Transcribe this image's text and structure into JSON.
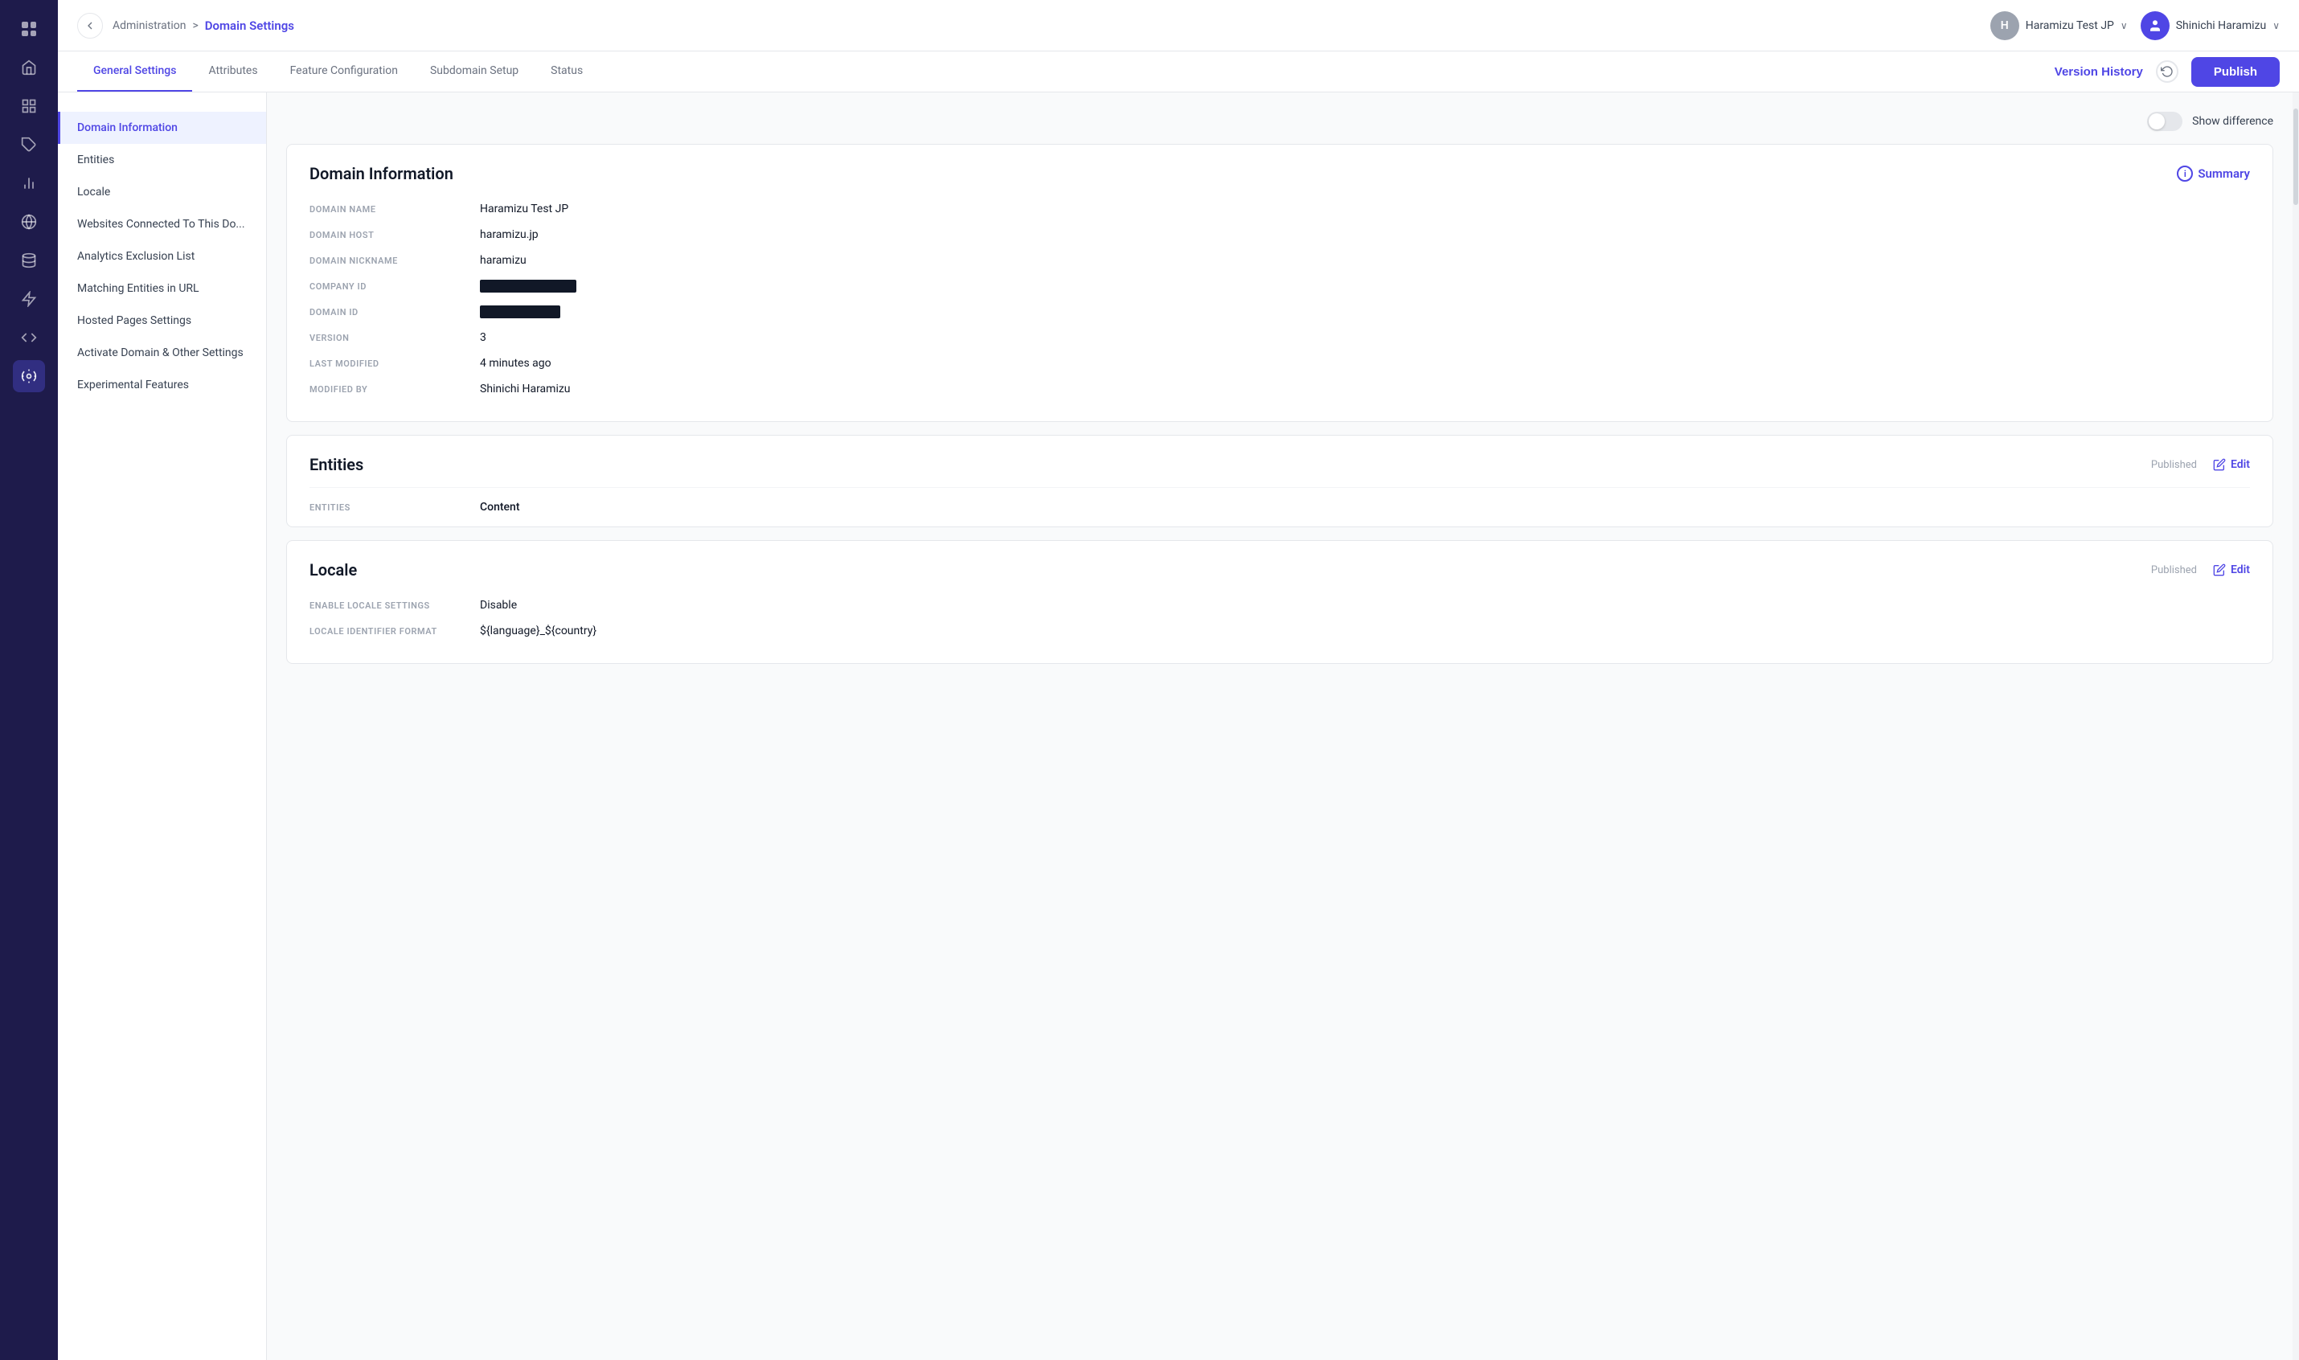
{
  "app": {
    "title": "Domain Settings"
  },
  "header": {
    "back_label": "←",
    "breadcrumb_admin": "Administration",
    "breadcrumb_sep": ">",
    "breadcrumb_current": "Domain Settings",
    "org_initial": "H",
    "org_name": "Haramizu Test JP",
    "chevron": "∨",
    "user_icon": "👤",
    "user_name": "Shinichi Haramizu"
  },
  "tabs": {
    "items": [
      {
        "label": "General Settings",
        "active": true
      },
      {
        "label": "Attributes",
        "active": false
      },
      {
        "label": "Feature Configuration",
        "active": false
      },
      {
        "label": "Subdomain Setup",
        "active": false
      },
      {
        "label": "Status",
        "active": false
      }
    ],
    "version_history": "Version History",
    "publish": "Publish"
  },
  "left_nav": {
    "items": [
      {
        "label": "Domain Information",
        "active": true
      },
      {
        "label": "Entities",
        "active": false
      },
      {
        "label": "Locale",
        "active": false
      },
      {
        "label": "Websites Connected To This Do...",
        "active": false
      },
      {
        "label": "Analytics Exclusion List",
        "active": false
      },
      {
        "label": "Matching Entities in URL",
        "active": false
      },
      {
        "label": "Hosted Pages Settings",
        "active": false
      },
      {
        "label": "Activate Domain & Other Settings",
        "active": false
      },
      {
        "label": "Experimental Features",
        "active": false
      }
    ]
  },
  "show_difference": {
    "label": "Show difference"
  },
  "domain_information": {
    "title": "Domain Information",
    "summary_label": "Summary",
    "fields": [
      {
        "label": "DOMAIN NAME",
        "value": "Haramizu Test JP",
        "redacted": false
      },
      {
        "label": "DOMAIN HOST",
        "value": "haramizu.jp",
        "redacted": false
      },
      {
        "label": "DOMAIN NICKNAME",
        "value": "haramizu",
        "redacted": false
      },
      {
        "label": "COMPANY ID",
        "value": "",
        "redacted": true
      },
      {
        "label": "DOMAIN ID",
        "value": "",
        "redacted": true
      },
      {
        "label": "VERSION",
        "value": "3",
        "redacted": false
      },
      {
        "label": "LAST MODIFIED",
        "value": "4 minutes ago",
        "redacted": false
      },
      {
        "label": "MODIFIED BY",
        "value": "Shinichi Haramizu",
        "redacted": false
      }
    ]
  },
  "entities_section": {
    "title": "Entities",
    "status": "Published",
    "edit_label": "Edit",
    "field_label": "ENTITIES",
    "field_value": "Content"
  },
  "locale_section": {
    "title": "Locale",
    "status": "Published",
    "edit_label": "Edit",
    "fields": [
      {
        "label": "ENABLE LOCALE SETTINGS",
        "value": "Disable"
      },
      {
        "label": "LOCALE IDENTIFIER FORMAT",
        "value": "${language}_${country}"
      }
    ]
  },
  "sidebar_icons": [
    {
      "name": "grid-icon",
      "symbol": "⊞",
      "active": false
    },
    {
      "name": "home-icon",
      "symbol": "⌂",
      "active": false
    },
    {
      "name": "layout-icon",
      "symbol": "▦",
      "active": false
    },
    {
      "name": "puzzle-icon",
      "symbol": "⬡",
      "active": false
    },
    {
      "name": "chart-icon",
      "symbol": "▮",
      "active": false
    },
    {
      "name": "globe-icon",
      "symbol": "⊕",
      "active": false
    },
    {
      "name": "database-icon",
      "symbol": "⊜",
      "active": false
    },
    {
      "name": "plugin-icon",
      "symbol": "⚡",
      "active": false
    },
    {
      "name": "code-icon",
      "symbol": "</>",
      "active": false
    },
    {
      "name": "settings-icon",
      "symbol": "⚙",
      "active": true
    }
  ]
}
